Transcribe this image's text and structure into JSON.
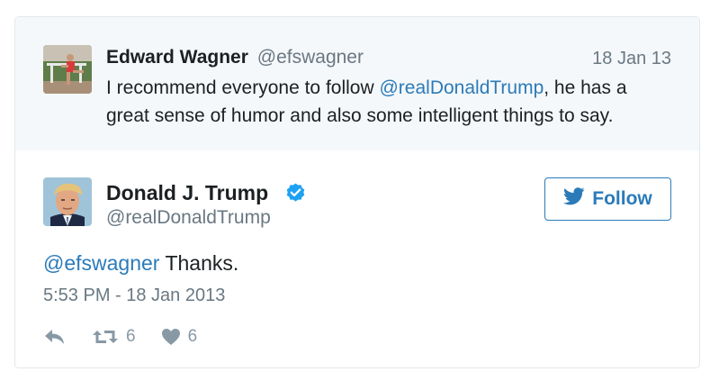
{
  "parent_tweet": {
    "author_name": "Edward Wagner",
    "author_handle": "@efswagner",
    "date": "18 Jan 13",
    "text_before": "I recommend everyone to follow ",
    "mention": "@realDonaldTrump",
    "text_after": ", he has a great sense of humor and also some intelligent things to say."
  },
  "main_tweet": {
    "author_name": "Donald J. Trump",
    "author_handle": "@realDonaldTrump",
    "verified": true,
    "follow_label": "Follow",
    "reply_mention": "@efswagner",
    "text": " Thanks.",
    "timestamp": "5:53 PM - 18 Jan 2013",
    "retweet_count": "6",
    "like_count": "6"
  },
  "colors": {
    "link": "#2b7bb9",
    "muted": "#697882",
    "icon": "#8899a6",
    "parent_bg": "#f5f8fa",
    "verified": "#1da1f2"
  },
  "icons": {
    "reply": "reply-icon",
    "retweet": "retweet-icon",
    "like": "heart-icon",
    "follow": "twitter-bird-icon",
    "verified": "verified-badge-icon"
  }
}
